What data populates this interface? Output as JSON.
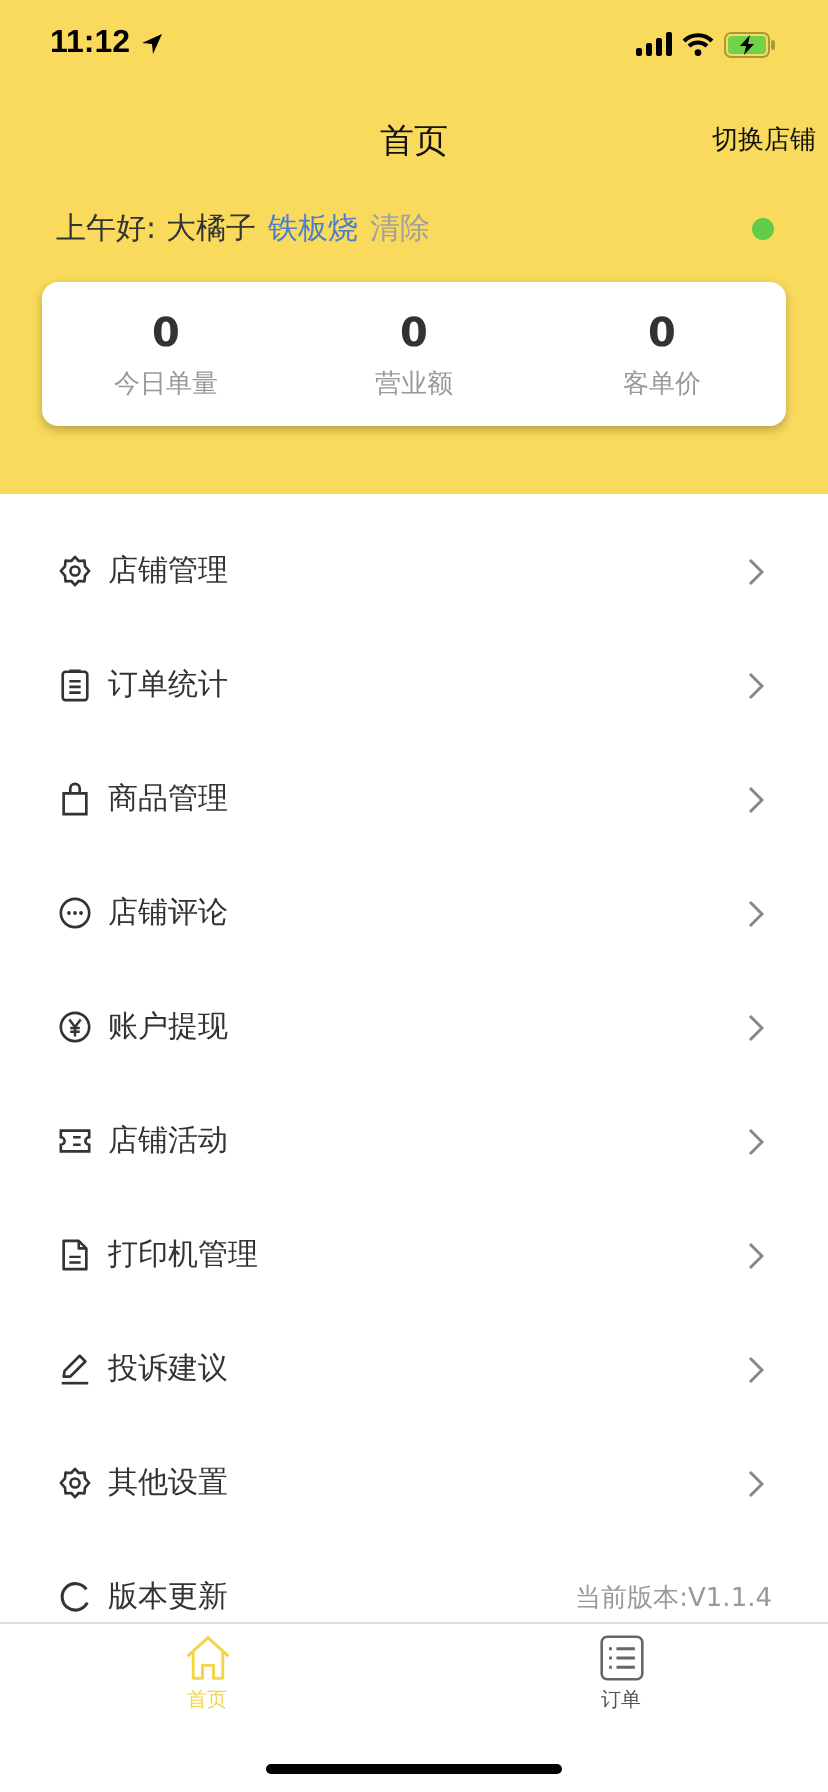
{
  "status_bar": {
    "time": "11:12"
  },
  "nav": {
    "title": "首页",
    "action": "切换店铺"
  },
  "greeting": {
    "text": "上午好: 大橘子",
    "shop": "铁板烧",
    "clear": "清除",
    "online": true
  },
  "stats": [
    {
      "value": "0",
      "label": "今日单量"
    },
    {
      "value": "0",
      "label": "营业额"
    },
    {
      "value": "0",
      "label": "客单价"
    }
  ],
  "menu": [
    {
      "kind": "link",
      "label": "店铺管理"
    },
    {
      "kind": "link",
      "label": "订单统计"
    },
    {
      "kind": "link",
      "label": "商品管理"
    },
    {
      "kind": "link",
      "label": "店铺评论"
    },
    {
      "kind": "link",
      "label": "账户提现"
    },
    {
      "kind": "link",
      "label": "店铺活动"
    },
    {
      "kind": "link",
      "label": "打印机管理"
    },
    {
      "kind": "link",
      "label": "投诉建议"
    },
    {
      "kind": "link",
      "label": "其他设置"
    },
    {
      "kind": "version",
      "label": "版本更新",
      "value": "当前版本:V1.1.4"
    }
  ],
  "tabs": [
    {
      "label": "首页",
      "selected": true
    },
    {
      "label": "订单",
      "selected": false
    }
  ]
}
